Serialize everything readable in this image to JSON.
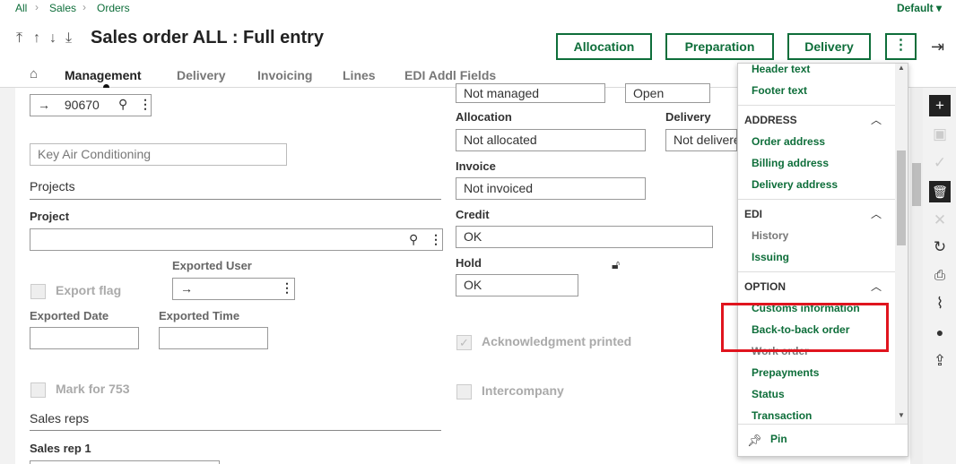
{
  "breadcrumb": {
    "items": [
      "All",
      "Sales",
      "Orders"
    ]
  },
  "default_selector": {
    "label": "Default"
  },
  "header": {
    "title": "Sales order ALL : Full entry",
    "buttons": {
      "allocation": "Allocation",
      "preparation": "Preparation",
      "delivery": "Delivery"
    }
  },
  "tabs": [
    "Management",
    "Delivery",
    "Invoicing",
    "Lines",
    "EDI Addl Fields"
  ],
  "form": {
    "customer_code": "90670",
    "customer_name_placeholder": "Key Air Conditioning",
    "projects_section": "Projects",
    "project_label": "Project",
    "project_value": "",
    "exported_flag_label": "Export flag",
    "exported_user_label": "Exported User",
    "exported_user_value": "",
    "exported_date_label": "Exported Date",
    "exported_date_value": "",
    "exported_time_label": "Exported Time",
    "exported_time_value": "",
    "mark_753_label": "Mark for 753",
    "sales_reps_section": "Sales reps",
    "sales_rep1_label": "Sales rep 1",
    "top_field_1": "Not managed",
    "top_field_2": "Open",
    "allocation_label": "Allocation",
    "allocation_value": "Not allocated",
    "delivery_label": "Delivery",
    "delivery_value": "Not delivered",
    "invoice_label": "Invoice",
    "invoice_value": "Not invoiced",
    "credit_label": "Credit",
    "credit_value": "OK",
    "hold_label": "Hold",
    "hold_value": "OK",
    "ack_printed_label": "Acknowledgment printed",
    "intercompany_label": "Intercompany"
  },
  "menu": {
    "top_items": [
      "Header text",
      "Footer text"
    ],
    "groups": {
      "address": {
        "title": "ADDRESS",
        "items": [
          "Order address",
          "Billing address",
          "Delivery address"
        ]
      },
      "edi": {
        "title": "EDI",
        "items": [
          "History",
          "Issuing"
        ]
      },
      "option": {
        "title": "OPTION",
        "items": [
          "Customs information",
          "Back-to-back order",
          "Work order",
          "Prepayments",
          "Status",
          "Transaction"
        ]
      }
    },
    "pin_label": "Pin"
  },
  "colors": {
    "brand_green": "#0e6e3a",
    "highlight_red": "#e0141e"
  },
  "icons": [
    "home-icon",
    "search-icon",
    "more-vert-icon",
    "arrow-right-icon",
    "unlock-icon",
    "logout-icon",
    "plus-icon",
    "save-icon",
    "check-icon",
    "trash-icon",
    "close-icon",
    "refresh-icon",
    "print-icon",
    "paperclip-icon",
    "comment-icon",
    "share-icon",
    "pin-icon"
  ]
}
